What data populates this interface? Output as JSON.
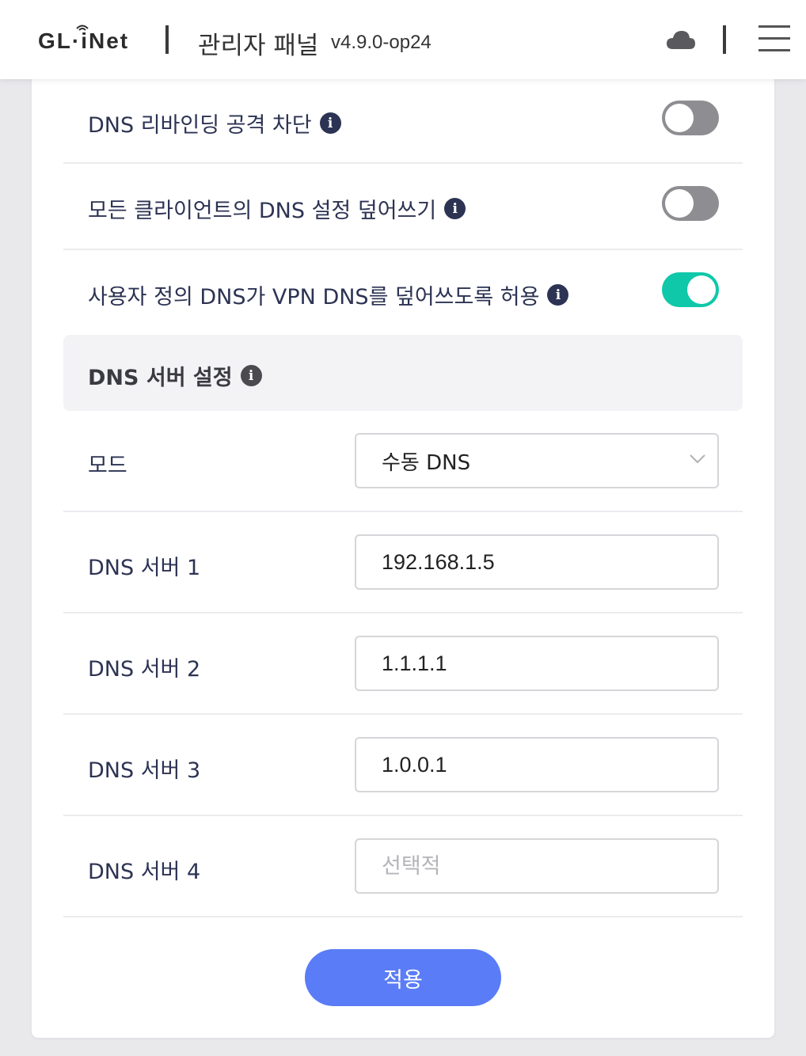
{
  "header": {
    "logo_text": "GL·iNet",
    "panel_title": "관리자 패널",
    "version": "v4.9.0-op24",
    "icons": [
      "cloud-icon",
      "menu-icon"
    ]
  },
  "toggles": [
    {
      "label": "DNS 리바인딩 공격 차단",
      "state": "off"
    },
    {
      "label": "모든 클라이언트의 DNS 설정 덮어쓰기",
      "state": "off"
    },
    {
      "label": "사용자 정의 DNS가 VPN DNS를 덮어쓰도록 허용",
      "state": "on"
    }
  ],
  "dns_server_settings": {
    "title": "DNS 서버 설정",
    "mode": {
      "label": "모드",
      "value": "수동 DNS"
    },
    "servers": [
      {
        "label": "DNS 서버 1",
        "value": "192.168.1.5",
        "placeholder": ""
      },
      {
        "label": "DNS 서버 2",
        "value": "1.1.1.1",
        "placeholder": ""
      },
      {
        "label": "DNS 서버 3",
        "value": "1.0.0.1",
        "placeholder": ""
      },
      {
        "label": "DNS 서버 4",
        "value": "",
        "placeholder": "선택적"
      }
    ]
  },
  "apply_button": "적용",
  "colors": {
    "toggle_on": "#0fc8a9",
    "toggle_off": "#8e8e92",
    "primary_button": "#5a7cf6",
    "label_text": "#2c3353"
  }
}
